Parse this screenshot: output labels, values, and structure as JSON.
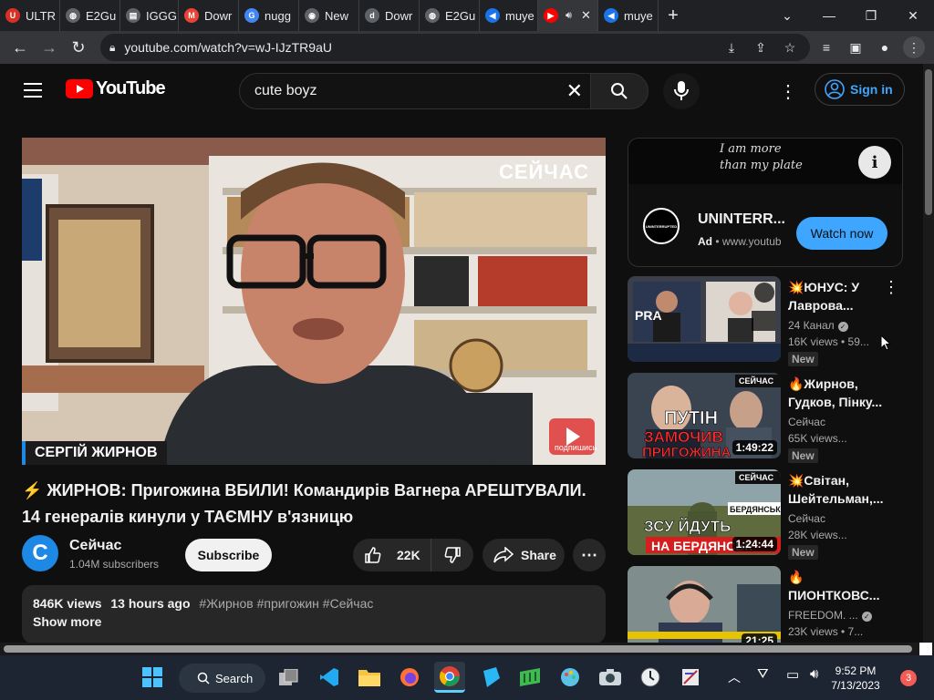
{
  "browser": {
    "tabs": [
      {
        "label": "ULTR",
        "fav_color": "#d93025",
        "fav_glyph": "U"
      },
      {
        "label": "E2Gu",
        "fav_color": "#5f6368",
        "fav_glyph": "◍"
      },
      {
        "label": "IGGG",
        "fav_color": "#5f6368",
        "fav_glyph": "▤"
      },
      {
        "label": "Dowr",
        "fav_color": "#ea4335",
        "fav_glyph": "M"
      },
      {
        "label": "nugg",
        "fav_color": "#4285f4",
        "fav_glyph": "G"
      },
      {
        "label": "New",
        "fav_color": "#5f6368",
        "fav_glyph": "◉"
      },
      {
        "label": "Dowr",
        "fav_color": "#5f6368",
        "fav_glyph": "d"
      },
      {
        "label": "E2Gu",
        "fav_color": "#5f6368",
        "fav_glyph": "◍"
      },
      {
        "label": "muye",
        "fav_color": "#1a73e8",
        "fav_glyph": "◀"
      },
      {
        "label": "",
        "fav_color": "#ff0000",
        "fav_glyph": "▶",
        "active": true
      },
      {
        "label": "muye",
        "fav_color": "#1a73e8",
        "fav_glyph": "◀"
      }
    ],
    "new_tab": "+",
    "url": "youtube.com/watch?v=wJ-IJzTR9aU"
  },
  "youtube": {
    "logo_text": "YouTube",
    "search_query": "cute boyz",
    "sign_in": "Sign in",
    "video": {
      "overlay_name": "СЕРГІЙ ЖИРНОВ",
      "watermark": "СЕЙЧАС",
      "subscribe_overlay": "подпишись",
      "title_line1": "⚡ ЖИРНОВ: Пригожина ВБИЛИ! Командирів Вагнера АРЕШТУВАЛИ.",
      "title_line2": "14 генералів кинули у ТАЄМНУ в'язницю",
      "channel_name": "Сейчас",
      "channel_initial": "C",
      "subscribers": "1.04M subscribers",
      "subscribe": "Subscribe",
      "likes": "22K",
      "share": "Share",
      "views": "846K views",
      "age": "13 hours ago",
      "hashtags": "#Жирнов #пригожин #Сейчас",
      "show_more": "Show more"
    },
    "ad": {
      "banner_text_1": "I am more",
      "banner_text_2": "than my plate",
      "name": "UNINTERR...",
      "ad_label": "Ad",
      "ad_url": "www.youtub",
      "cta": "Watch now",
      "logo_text": "UNINTERRUPTED"
    },
    "related": [
      {
        "title_1": "💥ЮНУС: У",
        "title_2": "Лаврова...",
        "channel": "24 Канал",
        "verified": true,
        "stats": "16K views • 59...",
        "badge": "New",
        "duration": ""
      },
      {
        "title_1": "🔥Жирнов,",
        "title_2": "Гудков, Пінку...",
        "channel": "Сейчас",
        "verified": false,
        "stats": "65K views...",
        "badge": "New",
        "duration": "1:49:22"
      },
      {
        "title_1": "💥Світан,",
        "title_2": "Шейтельман,...",
        "channel": "Сейчас",
        "verified": false,
        "stats": "28K views...",
        "badge": "New",
        "duration": "1:24:44"
      },
      {
        "title_1": "🔥",
        "title_2": "ПИОНТКОВС...",
        "channel": "FREEDOM. ...",
        "verified": true,
        "stats": "23K views • 7...",
        "badge": "",
        "duration": "21:25"
      }
    ],
    "thumb_text": {
      "t2_channel": "СЕЙЧАС",
      "t2_line1": "ПУТІН",
      "t2_line2": "ЗАМОЧИВ",
      "t2_line3": "ПРИГОЖИНА",
      "t3_channel": "СЕЙЧАС",
      "t3_place": "БЕРДЯНСЬК",
      "t3_line1": "ЗСУ ЙДУТЬ",
      "t3_line2": "НА БЕРДЯНСЬК"
    }
  },
  "taskbar": {
    "search": "Search",
    "time": "9:52 PM",
    "date": "7/13/2023",
    "notifications": "3"
  }
}
